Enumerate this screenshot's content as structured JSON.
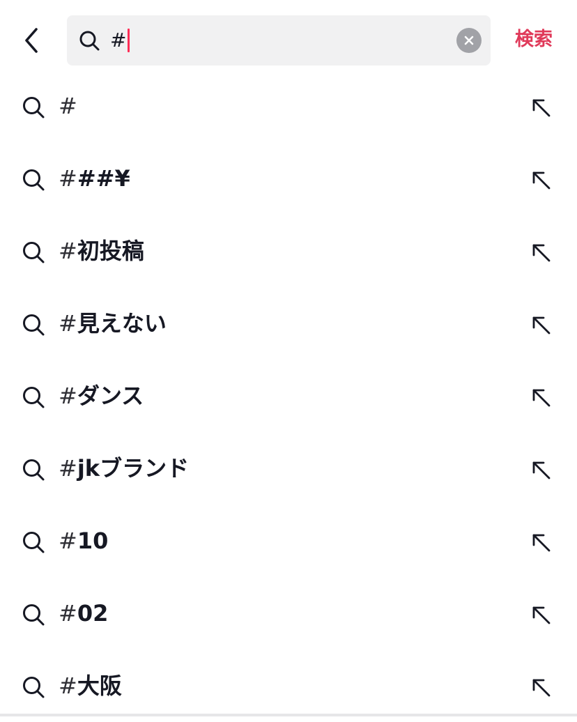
{
  "header": {
    "back_icon": "chevron-left-icon",
    "search": {
      "icon": "search-icon",
      "value": "#",
      "clear_icon": "close-circle-icon"
    },
    "search_action_label": "検索",
    "accent_color": "#e03a5a"
  },
  "suggestions": [
    {
      "hash": "#",
      "label": "",
      "icon": "search-icon",
      "fill_icon": "arrow-up-left-icon"
    },
    {
      "hash": "#",
      "label": "##¥",
      "icon": "search-icon",
      "fill_icon": "arrow-up-left-icon"
    },
    {
      "hash": "#",
      "label": "初投稿",
      "icon": "search-icon",
      "fill_icon": "arrow-up-left-icon"
    },
    {
      "hash": "# ",
      "label": "見えない",
      "icon": "search-icon",
      "fill_icon": "arrow-up-left-icon"
    },
    {
      "hash": "#",
      "label": "ダンス",
      "icon": "search-icon",
      "fill_icon": "arrow-up-left-icon"
    },
    {
      "hash": "#",
      "label": "jkブランド",
      "icon": "search-icon",
      "fill_icon": "arrow-up-left-icon"
    },
    {
      "hash": "#",
      "label": "10",
      "icon": "search-icon",
      "fill_icon": "arrow-up-left-icon"
    },
    {
      "hash": "#",
      "label": "02",
      "icon": "search-icon",
      "fill_icon": "arrow-up-left-icon"
    },
    {
      "hash": "#",
      "label": "大阪",
      "icon": "search-icon",
      "fill_icon": "arrow-up-left-icon"
    }
  ]
}
